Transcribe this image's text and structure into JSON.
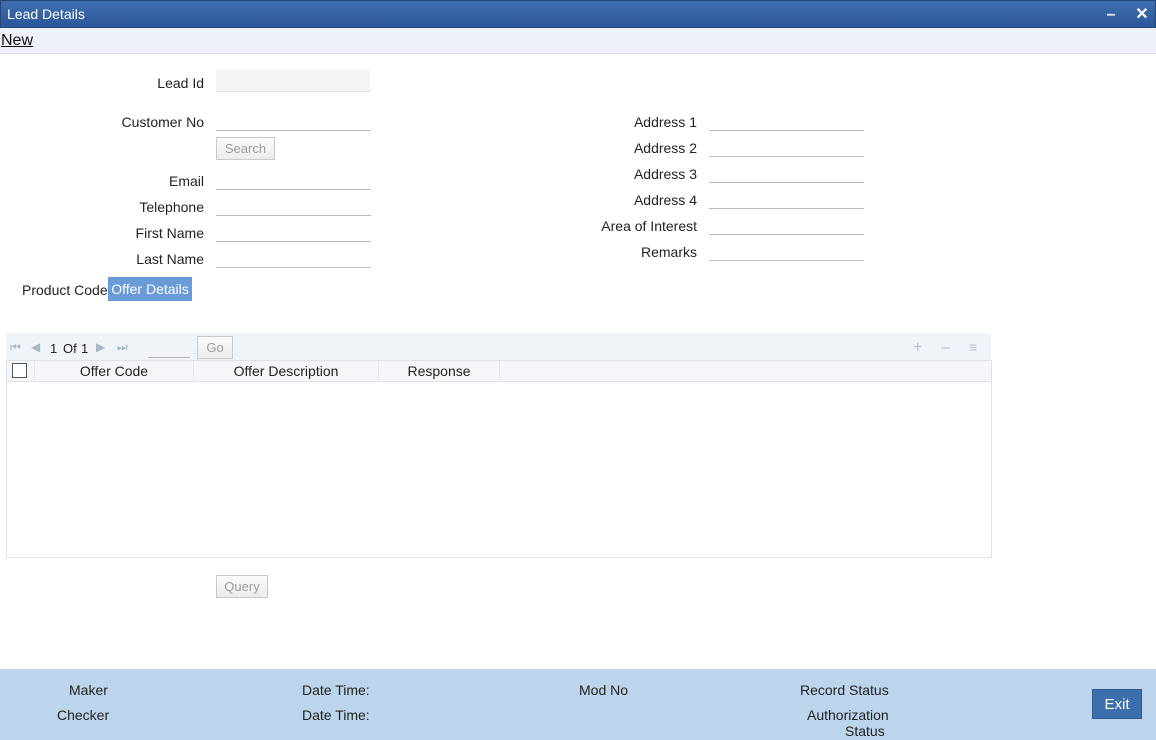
{
  "window": {
    "title": "Lead Details",
    "minimize_glyph": "–",
    "close_glyph": "✕"
  },
  "toolbar": {
    "new_label": "New"
  },
  "form": {
    "lead_id_label": "Lead Id",
    "customer_no_label": "Customer No",
    "search_label": "Search",
    "email_label": "Email",
    "telephone_label": "Telephone",
    "first_name_label": "First Name",
    "last_name_label": "Last Name",
    "address1_label": "Address 1",
    "address2_label": "Address 2",
    "address3_label": "Address 3",
    "address4_label": "Address 4",
    "area_of_interest_label": "Area of Interest",
    "remarks_label": "Remarks",
    "values": {
      "lead_id": "",
      "customer_no": "",
      "email": "",
      "telephone": "",
      "first_name": "",
      "last_name": "",
      "address1": "",
      "address2": "",
      "address3": "",
      "address4": "",
      "area_of_interest": "",
      "remarks": ""
    }
  },
  "tabs": {
    "product_code": "Product Code",
    "offer_details": "Offer Details"
  },
  "grid": {
    "page_current": "1",
    "page_of": "Of",
    "page_total": "1",
    "go_label": "Go",
    "columns": [
      "Offer Code",
      "Offer Description",
      "Response"
    ],
    "rows": [],
    "icons": {
      "first": "first-page-icon",
      "prev": "prev-page-icon",
      "next": "next-page-icon",
      "last": "last-page-icon",
      "add": "add-row-icon",
      "delete": "delete-row-icon",
      "columns": "column-view-icon"
    }
  },
  "query_label": "Query",
  "footer": {
    "maker_label": "Maker",
    "checker_label": "Checker",
    "date_time_label": "Date Time:",
    "date_time_label_2": "Date Time:",
    "mod_no_label": "Mod No",
    "record_status_label": "Record Status",
    "authorization_label": "Authorization",
    "status_label": "Status",
    "exit_label": "Exit"
  },
  "colors": {
    "titlebar": "#2f5d9f",
    "active_tab": "#6a9bd8",
    "footer": "#bcd4ec",
    "exit_button": "#3d6fab"
  }
}
